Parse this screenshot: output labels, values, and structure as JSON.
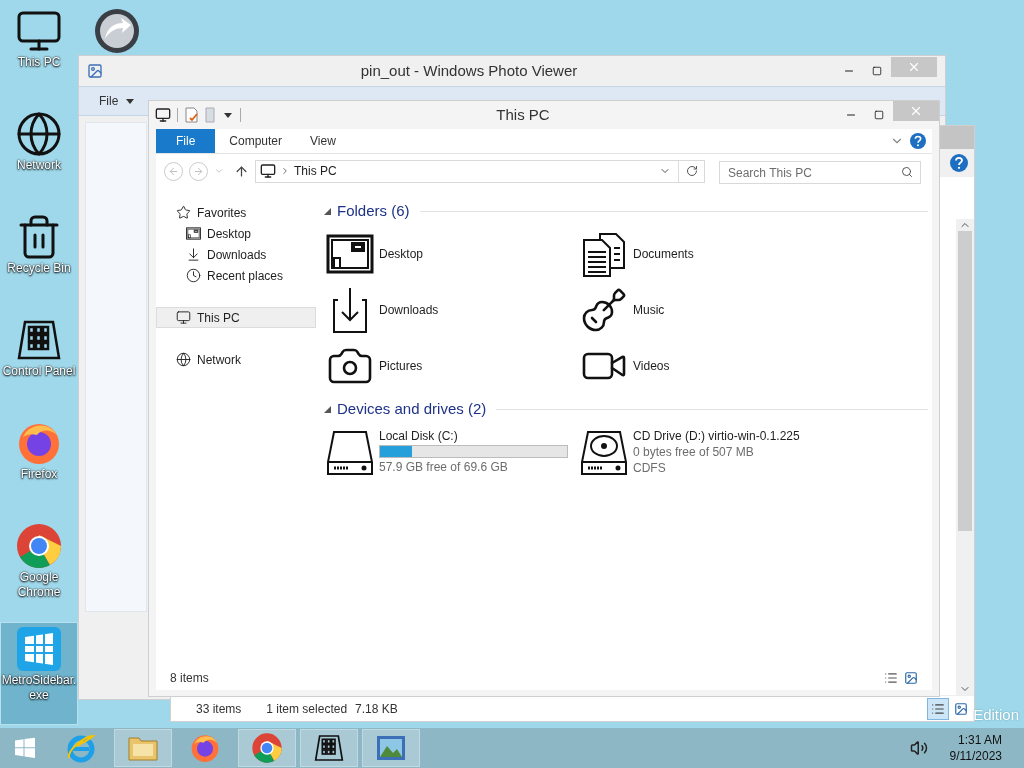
{
  "desktop_icons": [
    {
      "label": "This PC",
      "kind": "pc",
      "selected": false
    },
    {
      "label": "Network",
      "kind": "globe",
      "selected": false
    },
    {
      "label": "Recycle Bin",
      "kind": "bin",
      "selected": false
    },
    {
      "label": "Control Panel",
      "kind": "panel",
      "selected": false
    },
    {
      "label": "Firefox",
      "kind": "firefox",
      "selected": false
    },
    {
      "label": "Google Chrome",
      "kind": "chrome",
      "selected": false
    },
    {
      "label": "MetroSidebar.exe",
      "kind": "metro",
      "selected": true
    }
  ],
  "photo_viewer": {
    "title": "pin_out - Windows Photo Viewer",
    "menu": [
      {
        "label": "File",
        "dropdown": true
      }
    ]
  },
  "back_window": {
    "status": [
      "33 items",
      "1 item selected",
      "7.18 KB"
    ]
  },
  "explorer": {
    "title": "This PC",
    "ribbon_tabs": [
      {
        "label": "File",
        "selected": true
      },
      {
        "label": "Computer",
        "selected": false
      },
      {
        "label": "View",
        "selected": false
      }
    ],
    "address": "This PC",
    "search_placeholder": "Search This PC",
    "nav": [
      {
        "label": "Favorites",
        "kind": "star",
        "selected": false,
        "children": [
          {
            "label": "Desktop",
            "kind": "desktop",
            "selected": false
          },
          {
            "label": "Downloads",
            "kind": "download",
            "selected": false
          },
          {
            "label": "Recent places",
            "kind": "clock",
            "selected": false
          }
        ]
      },
      {
        "label": "This PC",
        "kind": "pc",
        "selected": true
      },
      {
        "label": "Network",
        "kind": "globe",
        "selected": false
      }
    ],
    "groups": [
      {
        "title": "Folders (6)",
        "items": [
          {
            "kind": "desktop",
            "label": "Desktop"
          },
          {
            "kind": "documents",
            "label": "Documents"
          },
          {
            "kind": "download",
            "label": "Downloads"
          },
          {
            "kind": "guitar",
            "label": "Music"
          },
          {
            "kind": "camera",
            "label": "Pictures"
          },
          {
            "kind": "video",
            "label": "Videos"
          }
        ]
      },
      {
        "title": "Devices and drives (2)",
        "items": [
          {
            "kind": "disk",
            "label": "Local Disk (C:)",
            "level": 0.17,
            "detail": "57.9 GB free of 69.6 GB"
          },
          {
            "kind": "cd",
            "label": "CD Drive (D:) virtio-win-0.1.225",
            "detail": "0 bytes free of 507 MB",
            "filesystem": "CDFS"
          }
        ]
      }
    ],
    "status": "8 items"
  },
  "taskbar": [
    {
      "kind": "ie",
      "running": false
    },
    {
      "kind": "folder",
      "running": true
    },
    {
      "kind": "firefox",
      "running": false
    },
    {
      "kind": "chrome",
      "running": true
    },
    {
      "kind": "panel",
      "running": true
    },
    {
      "kind": "photo",
      "running": true
    }
  ],
  "clock": {
    "time": "1:31 AM",
    "date": "9/11/2023"
  },
  "edition": "Edition"
}
